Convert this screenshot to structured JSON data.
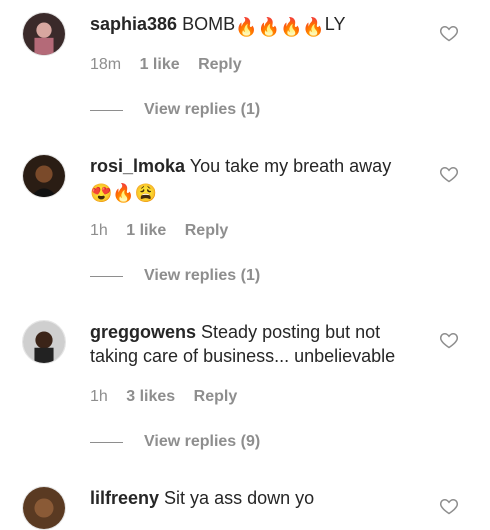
{
  "comments": [
    {
      "username": "saphia386",
      "text_before": "BOMB",
      "emojis": [
        "fire",
        "fire",
        "fire",
        "fire"
      ],
      "text_after": "LY",
      "time": "18m",
      "likes": "1 like",
      "reply": "Reply",
      "view_replies": "View replies (1)"
    },
    {
      "username": "rosi_lmoka",
      "text": "You take my breath away",
      "emojis": [
        "heart-eyes",
        "fire",
        "weary"
      ],
      "time": "1h",
      "likes": "1 like",
      "reply": "Reply",
      "view_replies": "View replies (1)"
    },
    {
      "username": "greggowens",
      "text": "Steady posting but not taking care of business... unbelievable",
      "time": "1h",
      "likes": "3 likes",
      "reply": "Reply",
      "view_replies": "View replies (9)"
    },
    {
      "username": "lilfreeny",
      "text": "Sit ya ass down yo"
    }
  ],
  "icons": {
    "like": "heart-outline-icon"
  },
  "colors": {
    "text": "#262626",
    "secondary": "#8e8e8e"
  }
}
